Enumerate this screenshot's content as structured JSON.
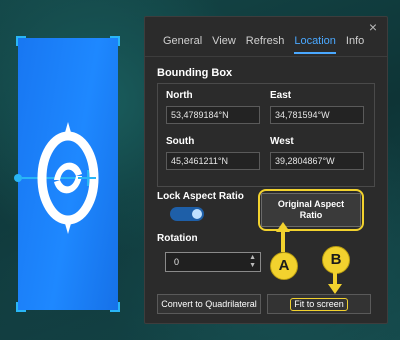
{
  "panel": {
    "close_icon": "×",
    "tabs": [
      {
        "label": "General",
        "active": false
      },
      {
        "label": "View",
        "active": false
      },
      {
        "label": "Refresh",
        "active": false
      },
      {
        "label": "Location",
        "active": true
      },
      {
        "label": "Info",
        "active": false
      }
    ],
    "section_title": "Bounding Box",
    "bounding_box": {
      "north": {
        "label": "North",
        "value": "53,4789184°N"
      },
      "east": {
        "label": "East",
        "value": "34,781594°W"
      },
      "south": {
        "label": "South",
        "value": "45,3461211°N"
      },
      "west": {
        "label": "West",
        "value": "39,2804867°W"
      }
    },
    "lock_aspect_ratio": {
      "label": "Lock Aspect Ratio",
      "enabled": true
    },
    "original_aspect_ratio_button": "Original Aspect Ratio",
    "rotation": {
      "label": "Rotation",
      "value": "0"
    },
    "convert_button": "Convert to Quadrilateral",
    "fit_button": "Fit to screen"
  },
  "callouts": {
    "a": "A",
    "b": "B"
  },
  "colors": {
    "accent": "#4aa8ff",
    "highlight": "#f2d22e",
    "overlay": "#1e88ff",
    "panel_bg": "#2b2b2b"
  }
}
